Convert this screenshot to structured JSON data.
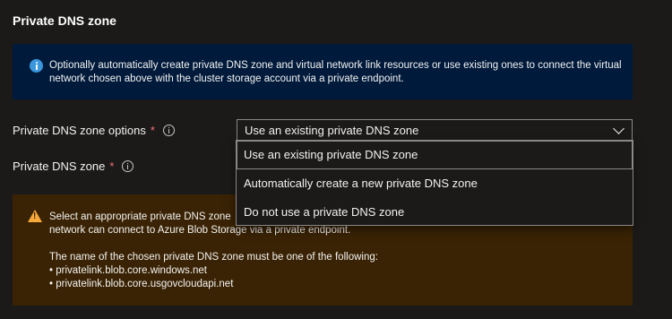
{
  "section": {
    "title": "Private DNS zone"
  },
  "info": {
    "icon": "info-icon",
    "text": "Optionally automatically create private DNS zone and virtual network link resources or use existing ones to connect the virtual network chosen above with the cluster storage account via a private endpoint."
  },
  "fields": {
    "zone_options": {
      "label": "Private DNS zone options",
      "required": "*",
      "value": "Use an existing private DNS zone"
    },
    "zone": {
      "label": "Private DNS zone",
      "required": "*"
    }
  },
  "dropdown": {
    "options": [
      "Use an existing private DNS zone",
      "Automatically create a new private DNS zone",
      "Do not use a private DNS zone"
    ],
    "selected_index": 0
  },
  "warning": {
    "icon": "warning-icon",
    "line1": "Select an appropriate private DNS zone",
    "line2": "network can connect to Azure Blob Storage via a private endpoint.",
    "line3": "The name of the chosen private DNS zone must be one of the following:",
    "items": [
      "• privatelink.blob.core.windows.net",
      "• privatelink.blob.core.usgovcloudapi.net"
    ]
  },
  "colors": {
    "background": "#1b1a19",
    "info_background": "#001a3b",
    "warning_background": "#3a2304",
    "info_icon": "#3a96dd",
    "warning_icon": "#f7a93b",
    "required": "#f1707b"
  }
}
